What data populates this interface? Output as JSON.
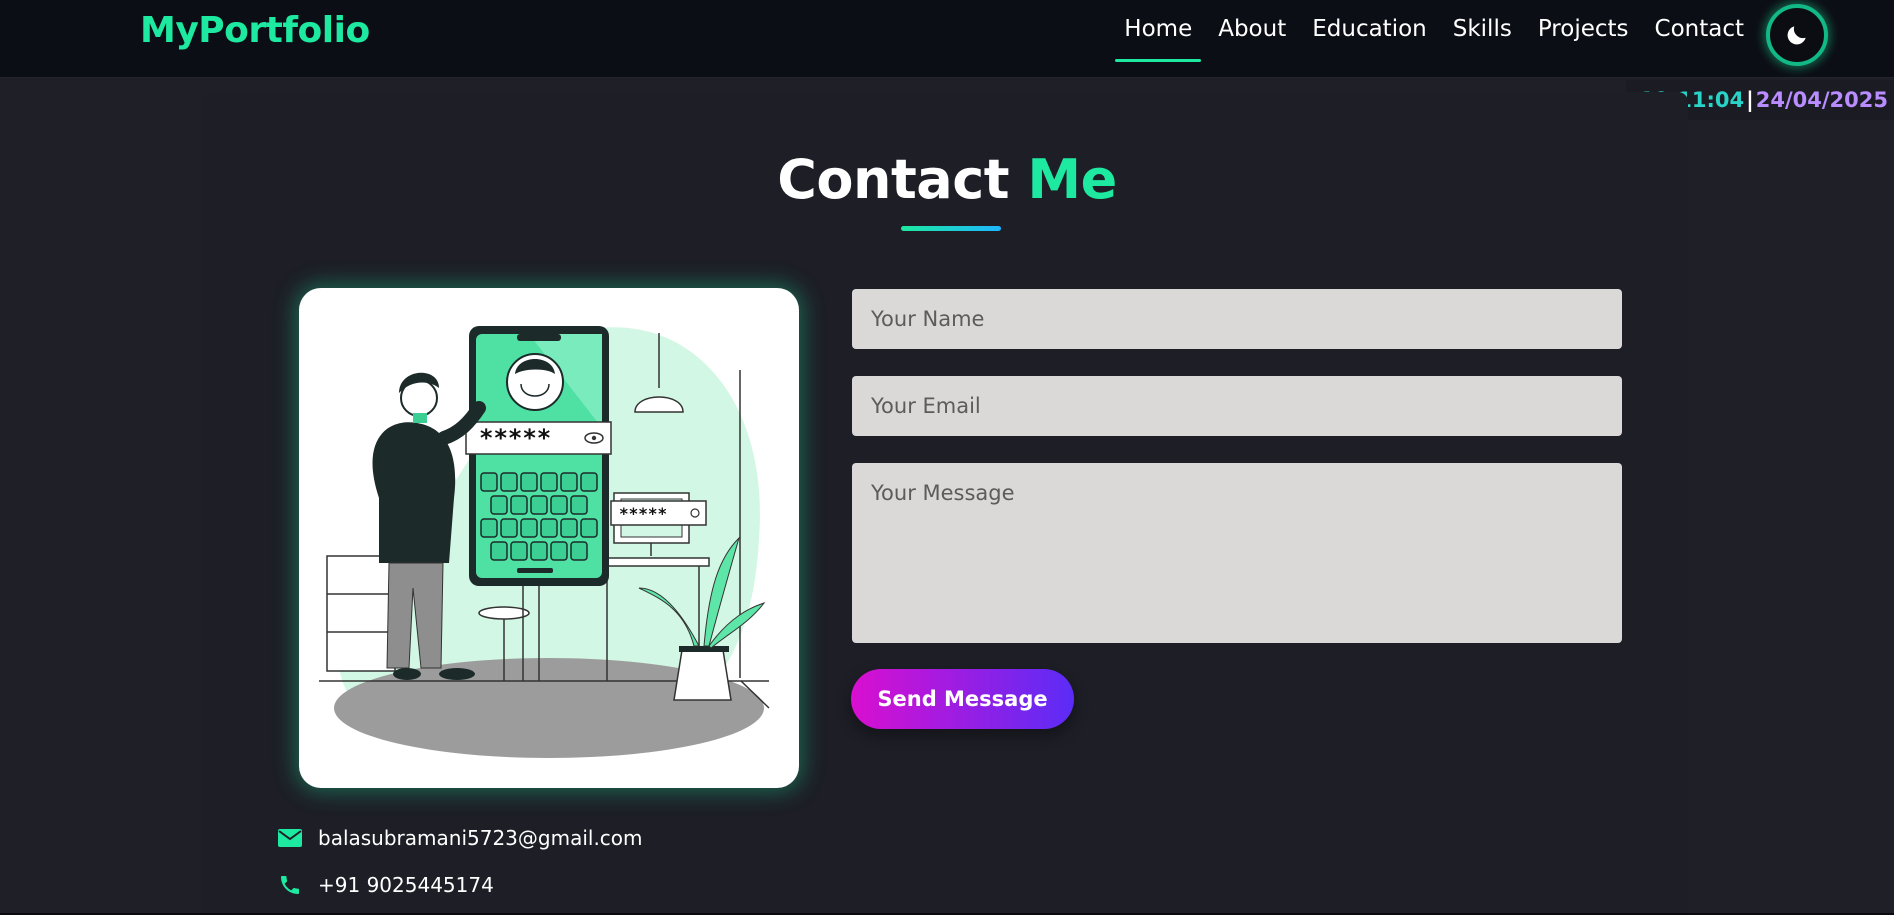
{
  "brand": {
    "logo": "MyPortfolio"
  },
  "nav": {
    "items": [
      {
        "label": "Home",
        "active": true
      },
      {
        "label": "About"
      },
      {
        "label": "Education"
      },
      {
        "label": "Skills"
      },
      {
        "label": "Projects"
      },
      {
        "label": "Contact"
      }
    ],
    "theme_toggle_icon": "moon-icon"
  },
  "clock": {
    "time": "19:11:04",
    "separator": "|",
    "date": "24/04/2025"
  },
  "section": {
    "title_main": "Contact",
    "title_accent": "Me"
  },
  "form": {
    "name_placeholder": "Your Name",
    "email_placeholder": "Your Email",
    "message_placeholder": "Your Message",
    "submit_label": "Send Message"
  },
  "illustration": {
    "password_mask": "*****"
  },
  "contact": {
    "email": "balasubramani5723@gmail.com",
    "email_icon": "envelope-icon",
    "phone": "+91 9025445174",
    "phone_icon": "phone-icon"
  },
  "colors": {
    "accent": "#1de9a0",
    "background": "#1f1f27",
    "navbar": "#0c0e15",
    "button_gradient_start": "#d90fd0",
    "button_gradient_end": "#5b2cf6",
    "clock_time": "#29d3c7",
    "clock_date": "#b98cff"
  }
}
